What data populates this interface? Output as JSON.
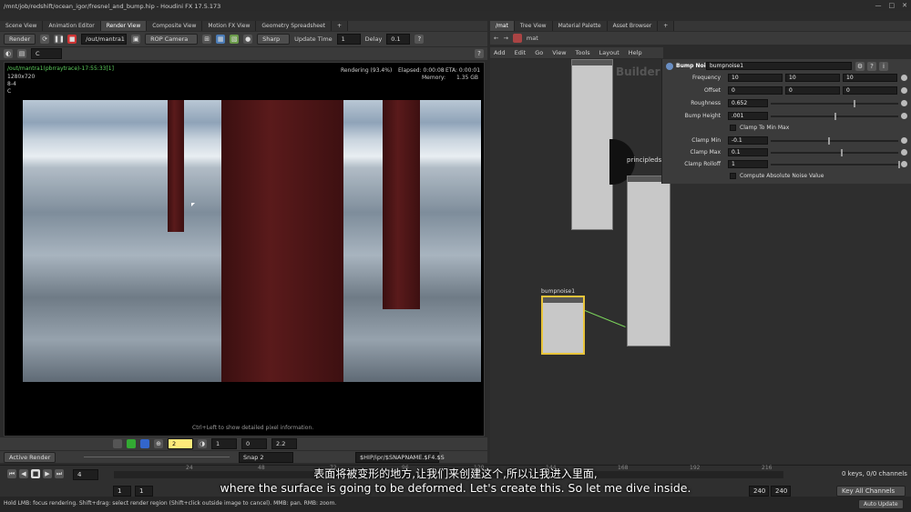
{
  "window": {
    "title": "/mnt/job/redshift/ocean_igor/fresnel_and_bump.hip - Houdini FX 17.5.173",
    "min": "—",
    "max": "□",
    "close": "✕"
  },
  "left_tabs": [
    "Scene View",
    "Animation Editor",
    "Render View",
    "Composite View",
    "Motion FX View",
    "Geometry Spreadsheet"
  ],
  "left_tab_add": "+",
  "render_toolbar": {
    "render_label": "Render",
    "rop_path": "/out/mantra1",
    "camera": "ROP Camera",
    "filter": "Sharp",
    "update_time_label": "Update Time",
    "update_time_value": "1",
    "delay_label": "Delay",
    "delay_value": "0.1",
    "channel": "C"
  },
  "viewport": {
    "path": "/out/mantra1(pbrraytrace)-17:55:33[1]",
    "resolution": "1280x720",
    "bits": "8-4",
    "channel": "C",
    "status": "Rendering (93.4%)",
    "elapsed": "Elapsed: 0:00:08",
    "eta": "ETA: 0:00:01",
    "memory_label": "Memory:",
    "memory_value": "1.35 GB",
    "hint": "Ctrl+Left to show detailed pixel information."
  },
  "viewport_bottom": {
    "frame_value": "2",
    "gamma": "1",
    "exposure": "0",
    "zoom": "2.2",
    "active_render": "Active Render",
    "snap": "Snap 2",
    "ship_path": "$HIP/ipr/$SNAPNAME.$F4.$S"
  },
  "right_tabs": [
    "/mat",
    "Tree View",
    "Material Palette",
    "Asset Browser"
  ],
  "right_tab_add": "+",
  "net_path": "mat",
  "net_menu": [
    "Add",
    "Edit",
    "Go",
    "View",
    "Tools",
    "Layout",
    "Help"
  ],
  "net_watermark": "Builder",
  "nodes": {
    "principled": "principledsha",
    "bump": "bumpnoise1"
  },
  "params": {
    "type_label": "Bump Noise",
    "node_name": "bumpnoise1",
    "rows": [
      {
        "label": "Frequency",
        "v1": "10",
        "v2": "10",
        "v3": "10"
      },
      {
        "label": "Offset",
        "v1": "0",
        "v2": "0",
        "v3": "0"
      },
      {
        "label": "Roughness",
        "v1": "0.652",
        "level": 0.65
      },
      {
        "label": "Bump Height",
        "v1": ".001",
        "level": 0.5
      },
      {
        "label": "Clamp To Min Max",
        "toggle": true
      },
      {
        "label": "Clamp Min",
        "v1": "-0.1",
        "level": 0.45
      },
      {
        "label": "Clamp Max",
        "v1": "0.1",
        "level": 0.55
      },
      {
        "label": "Clamp Rolloff",
        "v1": "1",
        "level": 1.0
      },
      {
        "label": "Compute Absolute Noise Value",
        "toggle": true
      }
    ]
  },
  "timeline": {
    "frame": "4",
    "start": "1",
    "start2": "1",
    "end1": "240",
    "end2": "240",
    "ticks": [
      "24",
      "48",
      "72",
      "96",
      "120",
      "144",
      "168",
      "192",
      "216"
    ],
    "keys": "0 keys, 0/0 channels",
    "key_all": "Key All Channels",
    "auto_update": "Auto Update"
  },
  "status": "Hold LMB: focus rendering. Shift+drag: select render region (Shift+click outside image to cancel). MMB: pan. RMB: zoom.",
  "subtitle": {
    "zh": "表面将被变形的地方,让我们来创建这个,所以让我进入里面,",
    "en": "where the surface is going to be deformed. Let's create this. So let me dive inside."
  }
}
